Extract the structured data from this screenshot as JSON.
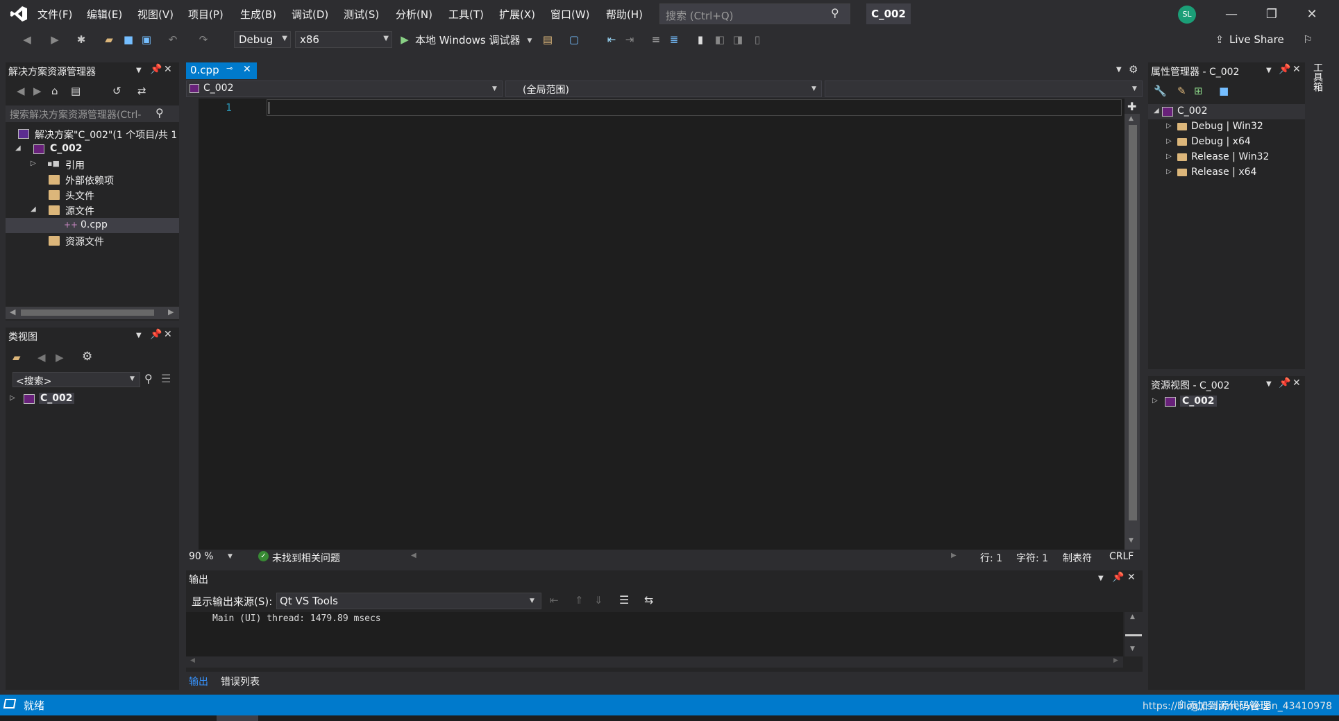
{
  "menu": [
    "文件(F)",
    "编辑(E)",
    "视图(V)",
    "项目(P)",
    "生成(B)",
    "调试(D)",
    "测试(S)",
    "分析(N)",
    "工具(T)",
    "扩展(X)",
    "窗口(W)",
    "帮助(H)"
  ],
  "search": {
    "placeholder": "搜索 (Ctrl+Q)"
  },
  "solution_badge": "C_002",
  "avatar_initials": "SL",
  "toolbar": {
    "config": "Debug",
    "platform": "x86",
    "run_label": "本地 Windows 调试器",
    "live_share": "Live Share"
  },
  "solution_explorer": {
    "title": "解决方案资源管理器",
    "search_placeholder": "搜索解决方案资源管理器(Ctrl-",
    "items": [
      {
        "label": "解决方案\"C_002\"(1 个项目/共 1"
      },
      {
        "label": "C_002"
      },
      {
        "label": "引用"
      },
      {
        "label": "外部依赖项"
      },
      {
        "label": "头文件"
      },
      {
        "label": "源文件"
      },
      {
        "label": "0.cpp"
      },
      {
        "label": "资源文件"
      }
    ]
  },
  "class_view": {
    "title": "类视图",
    "search": "<搜索>",
    "project": "C_002"
  },
  "editor": {
    "tab": "0.cpp",
    "nav_project": "C_002",
    "nav_scope": "(全局范围)",
    "line_number": "1",
    "zoom": "90 %",
    "issues": "未找到相关问题",
    "line": "行: 1",
    "col": "字符: 1",
    "tabs": "制表符",
    "eol": "CRLF"
  },
  "output": {
    "title": "输出",
    "source_label": "显示输出来源(S):",
    "source_value": "Qt VS Tools",
    "text": "Main (UI) thread: 1479.89 msecs",
    "tab_output": "输出",
    "tab_errors": "错误列表"
  },
  "properties": {
    "title": "属性管理器 - C_002",
    "project": "C_002",
    "configs": [
      "Debug | Win32",
      "Debug | x64",
      "Release | Win32",
      "Release | x64"
    ]
  },
  "resource_view": {
    "title": "资源视图 - C_002",
    "project": "C_002"
  },
  "toolbox_label": "工具箱",
  "status": {
    "ready": "就绪",
    "add_source": "添加到源代码管理",
    "watermark": "https://blog.csdn.net/weixin_43410978"
  }
}
